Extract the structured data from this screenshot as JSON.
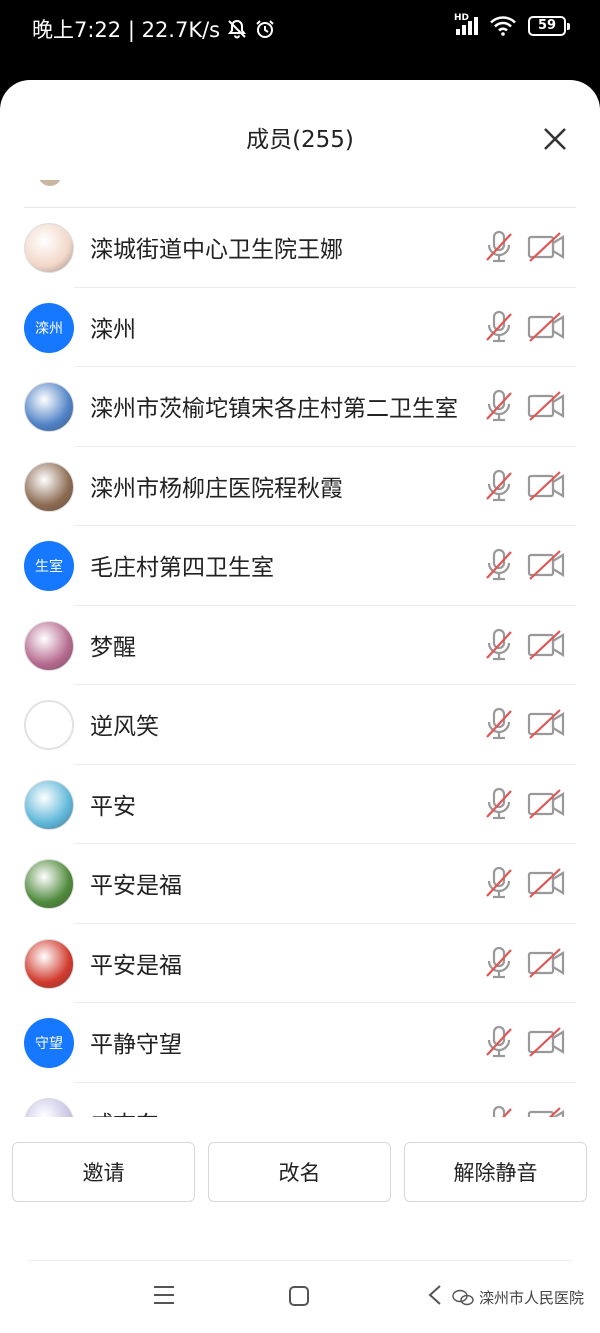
{
  "status_bar": {
    "time_speed": "晚上7:22 | 22.7K/s",
    "network": "HD",
    "battery": "59"
  },
  "sheet": {
    "title": "成员(255)"
  },
  "members": [
    {
      "name": "滦城街道中心卫生院王娜",
      "avatar_type": "image",
      "avatar_color": "#f2d7c9"
    },
    {
      "name": "滦州",
      "avatar_type": "text",
      "avatar_text": "滦州"
    },
    {
      "name": "滦州市茨榆坨镇宋各庄村第二卫生室",
      "avatar_type": "image",
      "avatar_color": "#4f82c6"
    },
    {
      "name": "滦州市杨柳庄医院程秋霞",
      "avatar_type": "image",
      "avatar_color": "#8c6b52"
    },
    {
      "name": "毛庄村第四卫生室",
      "avatar_type": "text",
      "avatar_text": "生室"
    },
    {
      "name": "梦醒",
      "avatar_type": "image",
      "avatar_color": "#b56a8f"
    },
    {
      "name": "逆风笑",
      "avatar_type": "blank"
    },
    {
      "name": "平安",
      "avatar_type": "image",
      "avatar_color": "#5fb7d9"
    },
    {
      "name": "平安是福",
      "avatar_type": "image",
      "avatar_color": "#4f8a3c"
    },
    {
      "name": "平安是福",
      "avatar_type": "image",
      "avatar_color": "#d13b2e"
    },
    {
      "name": "平静守望",
      "avatar_type": "text",
      "avatar_text": "守望"
    },
    {
      "name": "戚志东",
      "avatar_type": "image",
      "avatar_color": "#c9c6e6"
    }
  ],
  "icons": {
    "mic": "mic-muted-icon",
    "camera": "camera-off-icon",
    "accent_blue": "#1677ff",
    "muted_red": "#e05555"
  },
  "buttons": {
    "invite": "邀请",
    "rename": "改名",
    "unmute": "解除静音"
  },
  "watermark": {
    "text": "滦州市人民医院"
  }
}
